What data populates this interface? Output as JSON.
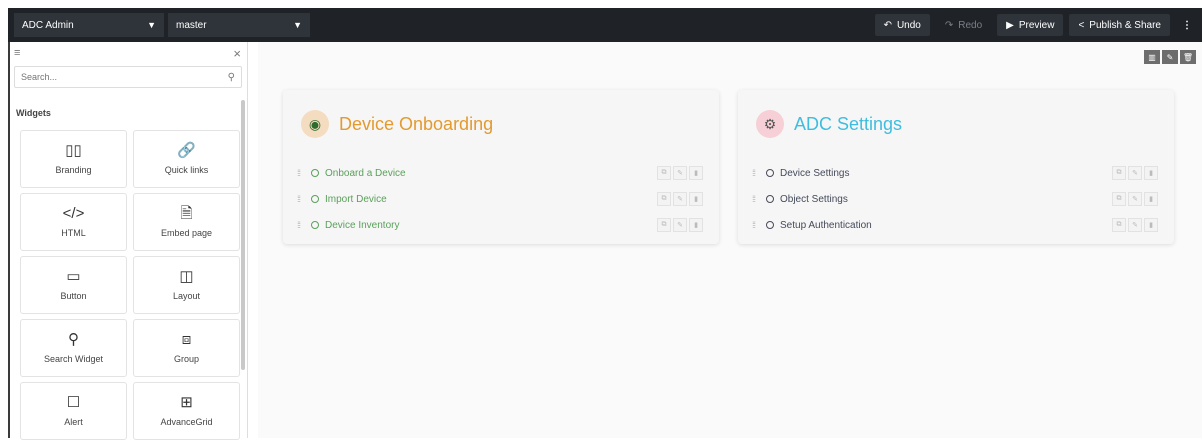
{
  "topbar": {
    "app_select": "ADC Admin",
    "branch_select": "master",
    "undo_label": "Undo",
    "redo_label": "Redo",
    "preview_label": "Preview",
    "publish_label": "Publish & Share",
    "more_glyph": "⋮"
  },
  "sidebar": {
    "search_placeholder": "Search...",
    "section_label": "Widgets",
    "widgets": [
      {
        "label": "Branding",
        "icon": "branding-icon",
        "glyph": "▯▯"
      },
      {
        "label": "Quick links",
        "icon": "link-icon",
        "glyph": "🔗"
      },
      {
        "label": "HTML",
        "icon": "code-icon",
        "glyph": "</>"
      },
      {
        "label": "Embed page",
        "icon": "document-icon",
        "glyph": "🗎"
      },
      {
        "label": "Button",
        "icon": "button-icon",
        "glyph": "▭"
      },
      {
        "label": "Layout",
        "icon": "columns-icon",
        "glyph": "◫"
      },
      {
        "label": "Search Widget",
        "icon": "search-icon",
        "glyph": "⚲"
      },
      {
        "label": "Group",
        "icon": "group-icon",
        "glyph": "⧈"
      },
      {
        "label": "Alert",
        "icon": "alert-icon",
        "glyph": "☐"
      },
      {
        "label": "AdvanceGrid",
        "icon": "grid-icon",
        "glyph": "⊞"
      }
    ]
  },
  "cards": [
    {
      "title": "Device Onboarding",
      "icon": "device-onboarding-icon",
      "glyph": "◉",
      "title_color": "#e39a2e",
      "items": [
        "Onboard a Device",
        "Import Device",
        "Device Inventory"
      ]
    },
    {
      "title": "ADC Settings",
      "icon": "settings-computer-icon",
      "glyph": "⚙",
      "title_color": "#3fbde0",
      "items": [
        "Device Settings",
        "Object Settings",
        "Setup Authentication"
      ]
    }
  ]
}
